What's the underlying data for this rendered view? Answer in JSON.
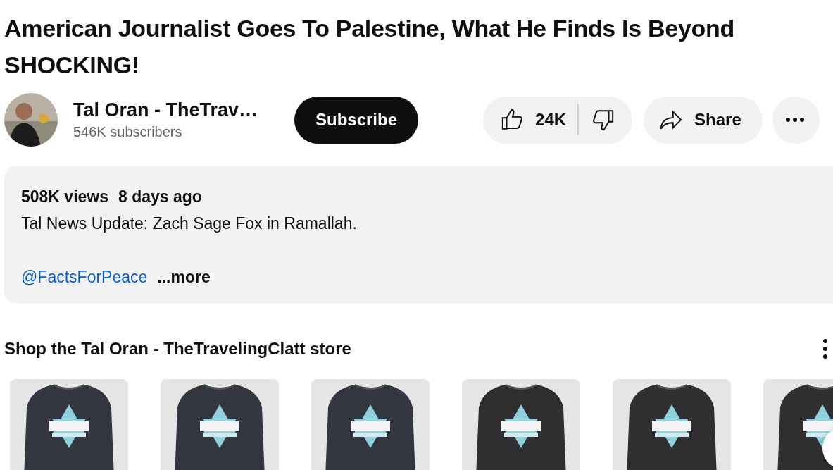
{
  "title": "American Journalist Goes To Palestine, What He Finds Is Beyond SHOCKING!",
  "channel": {
    "name": "Tal Oran - TheTrav…",
    "subscribers": "546K subscribers"
  },
  "subscribe": {
    "label": "Subscribe"
  },
  "actions": {
    "likes": "24K",
    "share": "Share"
  },
  "description": {
    "views": "508K views",
    "date": "8 days ago",
    "text": "Tal News Update: Zach Sage Fox in Ramallah.",
    "link": "@FactsForPeace",
    "more": "...more"
  },
  "store": {
    "title": "Shop the Tal Oran - TheTravelingClatt store"
  }
}
